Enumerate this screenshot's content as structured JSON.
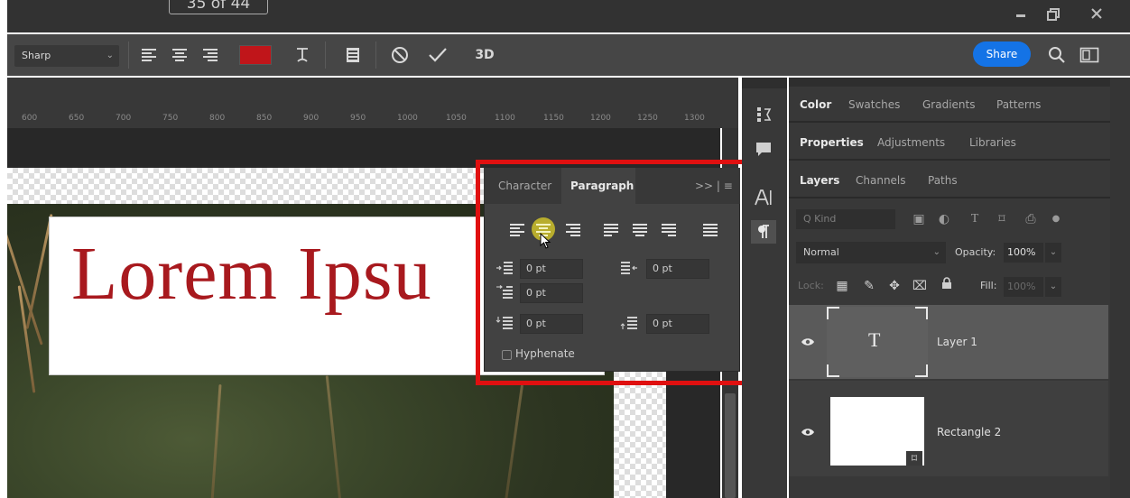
{
  "titlebar": {
    "page_counter": "35 of 44",
    "minimize_icon": "minimize-icon",
    "restore_icon": "restore-icon",
    "close_icon": "close-icon"
  },
  "options_bar": {
    "antialias_value": "Sharp",
    "text_color": "#c0151a",
    "mode_3d_label": "3D",
    "share_label": "Share"
  },
  "ruler": {
    "labels": [
      "600",
      "650",
      "700",
      "750",
      "800",
      "850",
      "900",
      "950",
      "1000",
      "1050",
      "1100",
      "1150",
      "1200",
      "1250",
      "1300"
    ]
  },
  "canvas": {
    "text": "Lorem Ipsu",
    "text_color": "#a8191e"
  },
  "paragraph_panel": {
    "tabs": [
      "Character",
      "Paragraph"
    ],
    "active_tab": "Paragraph",
    "menu": ">> | ≡",
    "indent_left": "0 pt",
    "indent_right": "0 pt",
    "indent_first_line": "0 pt",
    "space_before": "0 pt",
    "space_after": "0 pt",
    "hyphenate_label": "Hyphenate",
    "hyphenate_checked": false,
    "highlight_color": "#e01010"
  },
  "right_panels": {
    "group1_tabs": [
      "Color",
      "Swatches",
      "Gradients",
      "Patterns"
    ],
    "group2_tabs": [
      "Properties",
      "Adjustments",
      "Libraries"
    ],
    "group3_tabs": [
      "Layers",
      "Channels",
      "Paths"
    ],
    "filter_placeholder": "Q Kind",
    "blend_mode": "Normal",
    "opacity_label": "Opacity:",
    "opacity_value": "100%",
    "lock_label": "Lock:",
    "fill_label": "Fill:",
    "fill_value": "100%",
    "layers": [
      {
        "name": "Layer 1",
        "type": "text",
        "thumb_glyph": "T",
        "selected": true
      },
      {
        "name": "Rectangle 2",
        "type": "shape",
        "selected": false
      }
    ]
  },
  "accent_color": "#1473e6"
}
